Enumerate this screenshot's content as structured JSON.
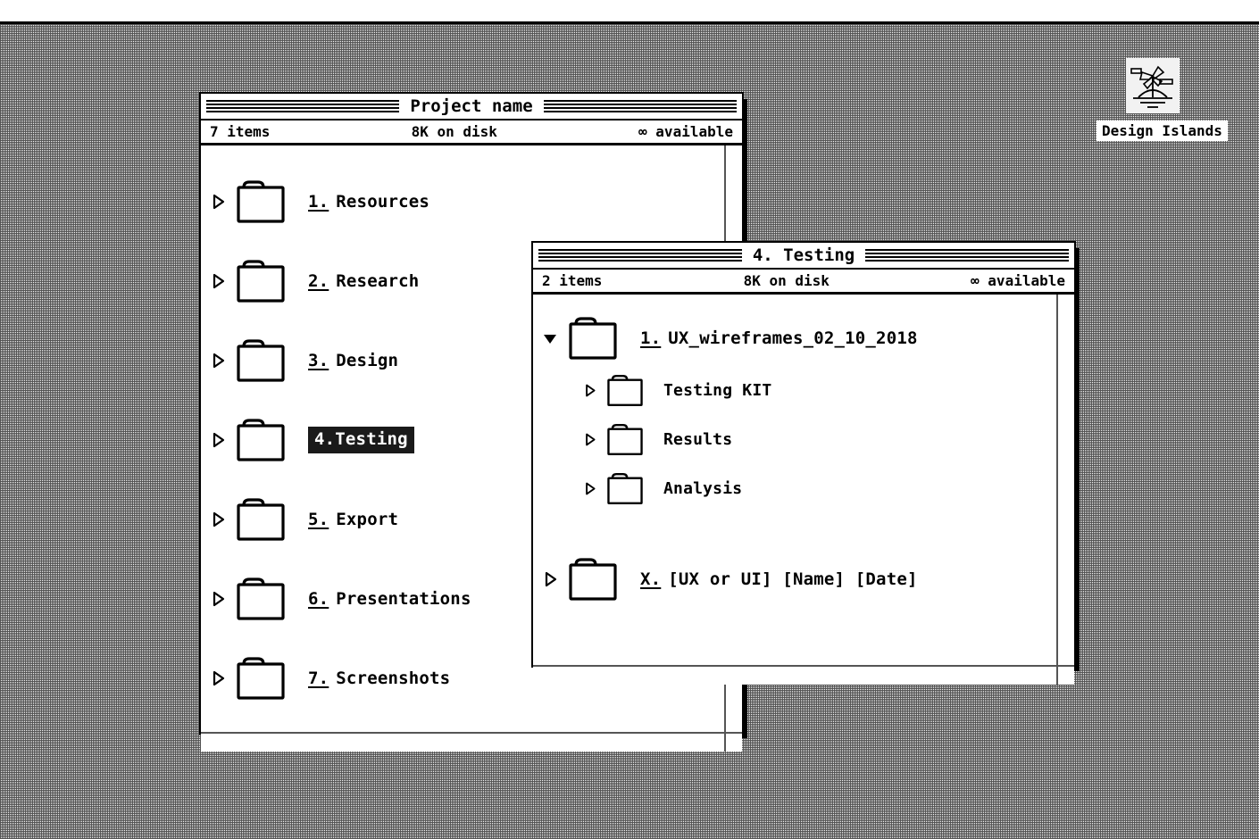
{
  "menubar": {
    "items": []
  },
  "logo": {
    "icon_name": "palm-island-icon",
    "text": "Design Islands"
  },
  "windows": [
    {
      "id": "project",
      "title": "Project name",
      "status": {
        "items": "7 items",
        "disk": "8K on disk",
        "available": "∞ available"
      },
      "rows": [
        {
          "num": "1.",
          "name": "Resources",
          "state": "collapsed",
          "selected": false
        },
        {
          "num": "2.",
          "name": "Research",
          "state": "collapsed",
          "selected": false
        },
        {
          "num": "3.",
          "name": "Design",
          "state": "collapsed",
          "selected": false
        },
        {
          "num": "4.",
          "name": "Testing",
          "state": "collapsed",
          "selected": true
        },
        {
          "num": "5.",
          "name": "Export",
          "state": "collapsed",
          "selected": false
        },
        {
          "num": "6.",
          "name": "Presentations",
          "state": "collapsed",
          "selected": false
        },
        {
          "num": "7.",
          "name": "Screenshots",
          "state": "collapsed",
          "selected": false
        }
      ]
    },
    {
      "id": "testing",
      "title": "4. Testing",
      "status": {
        "items": "2 items",
        "disk": "8K on disk",
        "available": "∞ available"
      },
      "rows": [
        {
          "num": "1.",
          "name": "UX_wireframes_02_10_2018",
          "state": "expanded",
          "selected": false,
          "level": 0
        },
        {
          "num": "",
          "name": "Testing KIT",
          "state": "collapsed",
          "selected": false,
          "level": 1
        },
        {
          "num": "",
          "name": "Results",
          "state": "collapsed",
          "selected": false,
          "level": 1
        },
        {
          "num": "",
          "name": "Analysis",
          "state": "collapsed",
          "selected": false,
          "level": 1
        },
        {
          "num": "X.",
          "name": "[UX or UI] [Name] [Date]",
          "state": "collapsed",
          "selected": false,
          "level": 0
        }
      ]
    }
  ]
}
